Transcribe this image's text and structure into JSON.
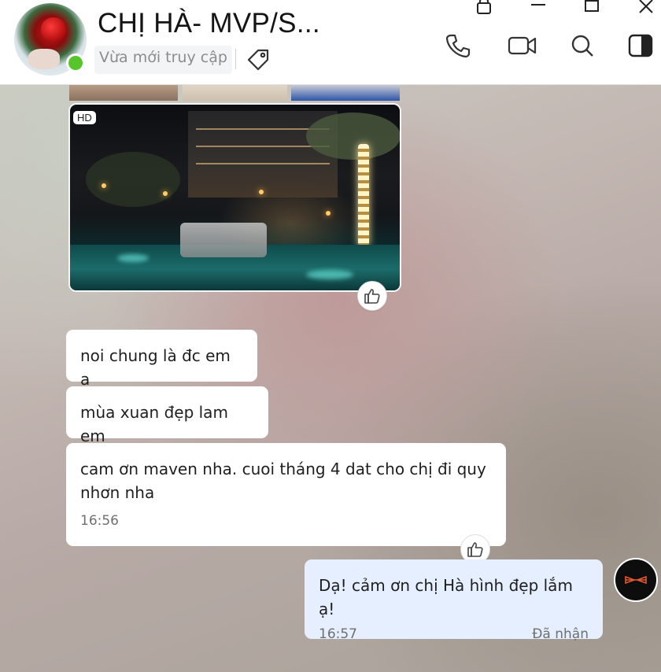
{
  "header": {
    "contact_name": "CHỊ HÀ- MVP/S...",
    "status": "Vừa mới truy cập",
    "online": true
  },
  "window_controls": [
    "lock-icon",
    "minimize-icon",
    "maximize-icon",
    "close-icon"
  ],
  "header_actions": [
    "phone-icon",
    "video-call-icon",
    "search-icon",
    "sidebar-toggle-icon"
  ],
  "media": {
    "hd_badge": "HD"
  },
  "messages": [
    {
      "text": "noi chung là đc em a"
    },
    {
      "text": "mùa xuan đẹp lam em"
    },
    {
      "text": "cam ơn maven nha. cuoi tháng 4 dat cho chị đi quy nhơn nha",
      "time": "16:56"
    }
  ],
  "sent_message": {
    "text": "Dạ! cảm ơn chị Hà hình đẹp lắm ạ!",
    "time": "16:57",
    "status": "Đã nhận"
  },
  "colors": {
    "online": "#56c52a",
    "sent_bubble": "#e5efff",
    "received_bubble": "#ffffff"
  }
}
